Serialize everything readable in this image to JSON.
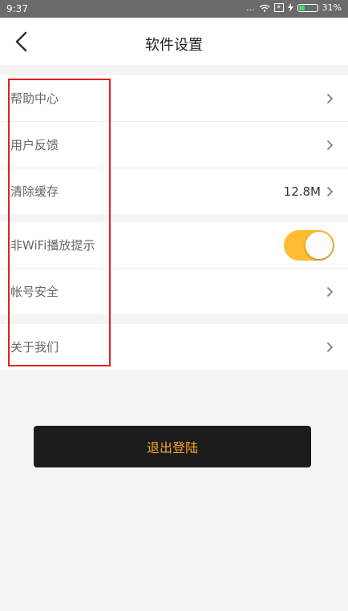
{
  "status_bar": {
    "time": "9:37",
    "signal_text": "...",
    "battery_percent": "31%",
    "battery_level": 0.31,
    "icons": [
      "wifi-icon",
      "sim-box-icon",
      "charging-icon",
      "battery-icon"
    ]
  },
  "header": {
    "title": "软件设置",
    "back_icon": "chevron-left-icon"
  },
  "groups": [
    [
      {
        "label": "帮助中心",
        "value": ""
      },
      {
        "label": "用户反馈",
        "value": ""
      },
      {
        "label": "清除缓存",
        "value": "12.8M"
      }
    ],
    [
      {
        "label": "非WiFi播放提示",
        "toggle": true
      },
      {
        "label": "帐号安全",
        "value": ""
      }
    ],
    [
      {
        "label": "关于我们",
        "value": ""
      }
    ]
  ],
  "logout_label": "退出登陆",
  "colors": {
    "accent": "#ffbb33",
    "logout_bg": "#1b1b1b",
    "logout_text": "#f5a623",
    "highlight_border": "#e02020"
  }
}
